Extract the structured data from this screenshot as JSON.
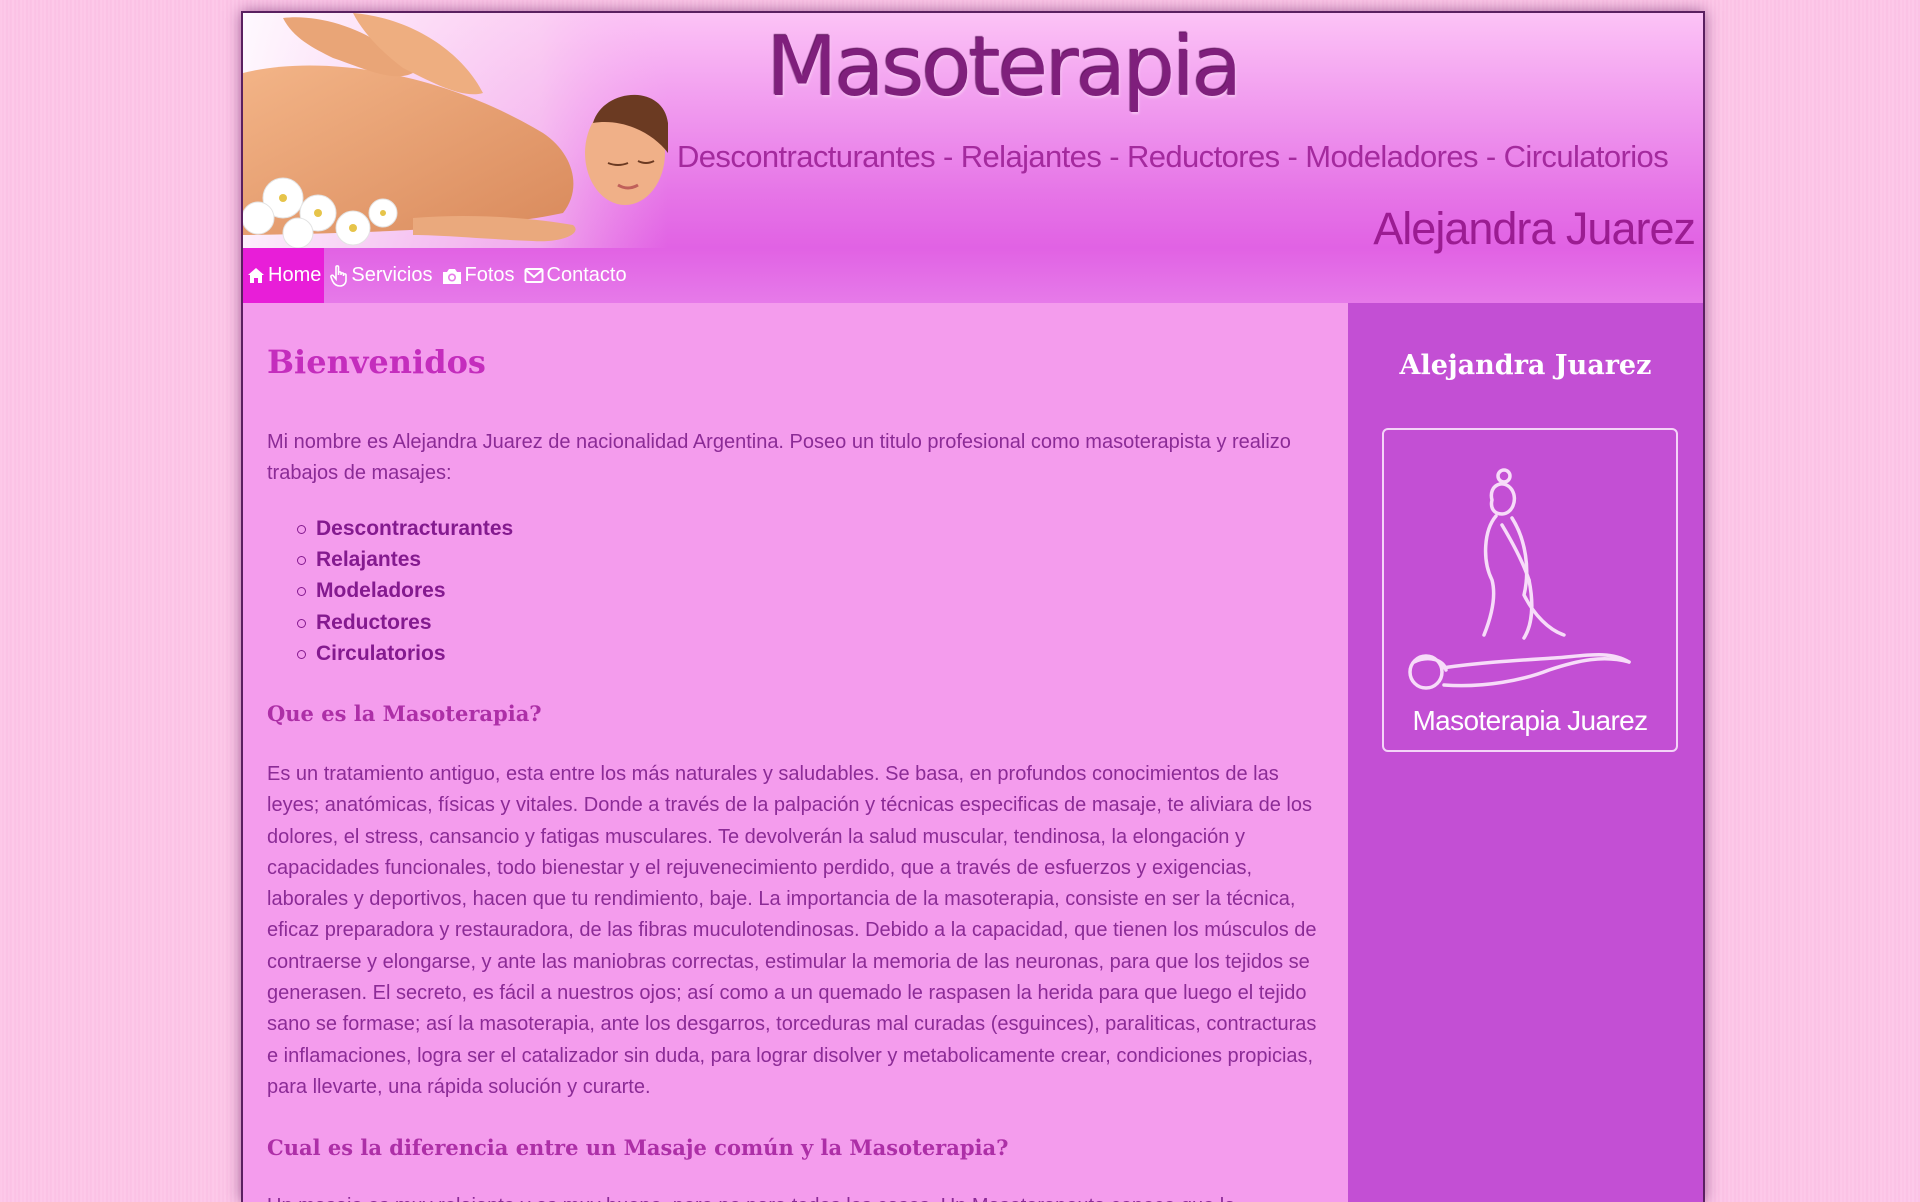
{
  "header": {
    "title": "Masoterapia",
    "tagline": "Descontracturantes - Relajantes - Reductores - Modeladores - Circulatorios",
    "owner": "Alejandra Juarez"
  },
  "nav": {
    "items": [
      {
        "label": "Home",
        "icon": "home-icon",
        "active": true
      },
      {
        "label": "Servicios",
        "icon": "hand-icon",
        "active": false
      },
      {
        "label": "Fotos",
        "icon": "camera-icon",
        "active": false
      },
      {
        "label": "Contacto",
        "icon": "envelope-icon",
        "active": false
      }
    ]
  },
  "main": {
    "heading": "Bienvenidos",
    "intro": "Mi nombre es Alejandra Juarez de nacionalidad Argentina. Poseo un titulo profesional como masoterapista y realizo trabajos de masajes:",
    "services": [
      "Descontracturantes",
      "Relajantes",
      "Modeladores",
      "Reductores",
      "Circulatorios"
    ],
    "question1": "Que es la Masoterapia?",
    "answer1": "Es un tratamiento antiguo, esta entre los más naturales y saludables. Se basa, en profundos conocimientos de las leyes; anatómicas, físicas y vitales. Donde a través de la palpación y técnicas especificas de masaje, te aliviara de los dolores, el stress, cansancio y fatigas musculares. Te devolverán la salud muscular, tendinosa, la elongación y capacidades funcionales, todo bienestar y el rejuvenecimiento perdido, que a través de esfuerzos y exigencias, laborales y deportivos, hacen que tu rendimiento, baje. La importancia de la masoterapia, consiste en ser la técnica, eficaz preparadora y restauradora, de las fibras muculotendinosas. Debido a la capacidad, que tienen los músculos de contraerse y elongarse, y ante las maniobras correctas, estimular la memoria de las neuronas, para que los tejidos se generasen. El secreto, es fácil a nuestros ojos; así como a un quemado le raspasen la herida para que luego el tejido sano se formase; así la masoterapia, ante los desgarros, torceduras mal curadas (esguinces), paraliticas, contracturas e inflamaciones, logra ser el catalizador sin duda, para lograr disolver y metabolicamente crear, condiciones propicias, para llevarte, una rápida solución y curarte.",
    "question2": "Cual es la diferencia entre un Masaje común y la Masoterapia?",
    "answer2": "Un masaje es muy relajante y es muy bueno, pero no para todos los casos. Un Masoterapeuta conoce que la"
  },
  "sidebar": {
    "title": "Alejandra Juarez",
    "logo_caption": "Masoterapia Juarez",
    "logo_icon": "massage-logo-icon"
  },
  "colors": {
    "accent": "#e81ed8",
    "sidebar": "#c34fd4",
    "text": "#8b2b96",
    "heading": "#c42dbd"
  }
}
